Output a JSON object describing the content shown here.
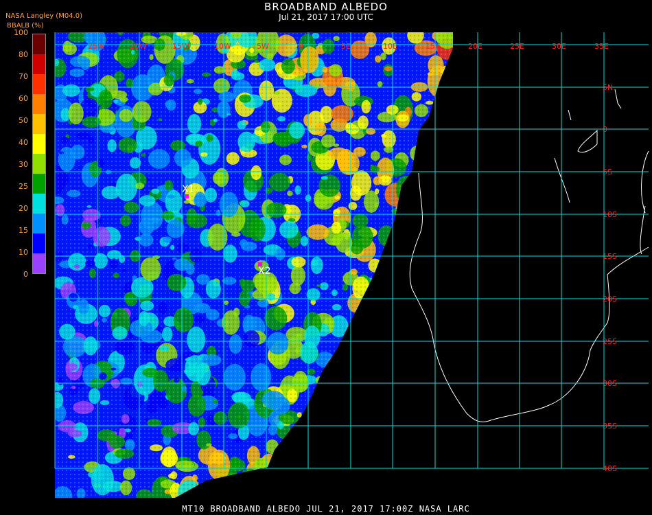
{
  "header": {
    "title": "BROADBAND ALBEDO",
    "subtitle": "Jul 21, 2017 17:00 UTC",
    "source": "NASA Langley (M04.0)",
    "param": "BBALB (%)"
  },
  "colorbar": {
    "ticks": [
      "100",
      "80",
      "70",
      "60",
      "50",
      "40",
      "30",
      "25",
      "20",
      "15",
      "10",
      "0"
    ],
    "colors": [
      "#6b0000",
      "#d00000",
      "#ff3000",
      "#ff8000",
      "#ffc000",
      "#ffff00",
      "#90e000",
      "#00a000",
      "#00e0e0",
      "#0090ff",
      "#0000ff",
      "#9a40ff"
    ]
  },
  "map": {
    "lon_labels": [
      "25W",
      "20W",
      "15W",
      "10W",
      "5W",
      "0",
      "5E",
      "10E",
      "15E",
      "20E",
      "25E",
      "30E",
      "35E"
    ],
    "lat_labels": [
      "5N",
      "0",
      "5S",
      "10S",
      "15S",
      "20S",
      "25S",
      "30S",
      "35S",
      "40S"
    ],
    "grid_color": "#00e0e0",
    "label_color": "#ff2020",
    "markers": [
      {
        "label": "X1",
        "color": "#ff00ff"
      },
      {
        "label": "X2",
        "color": "#ff00ff"
      }
    ]
  },
  "footer": {
    "text": "MT10  BROADBAND ALBEDO   JUL 21, 2017 17:00Z   NASA LARC"
  }
}
